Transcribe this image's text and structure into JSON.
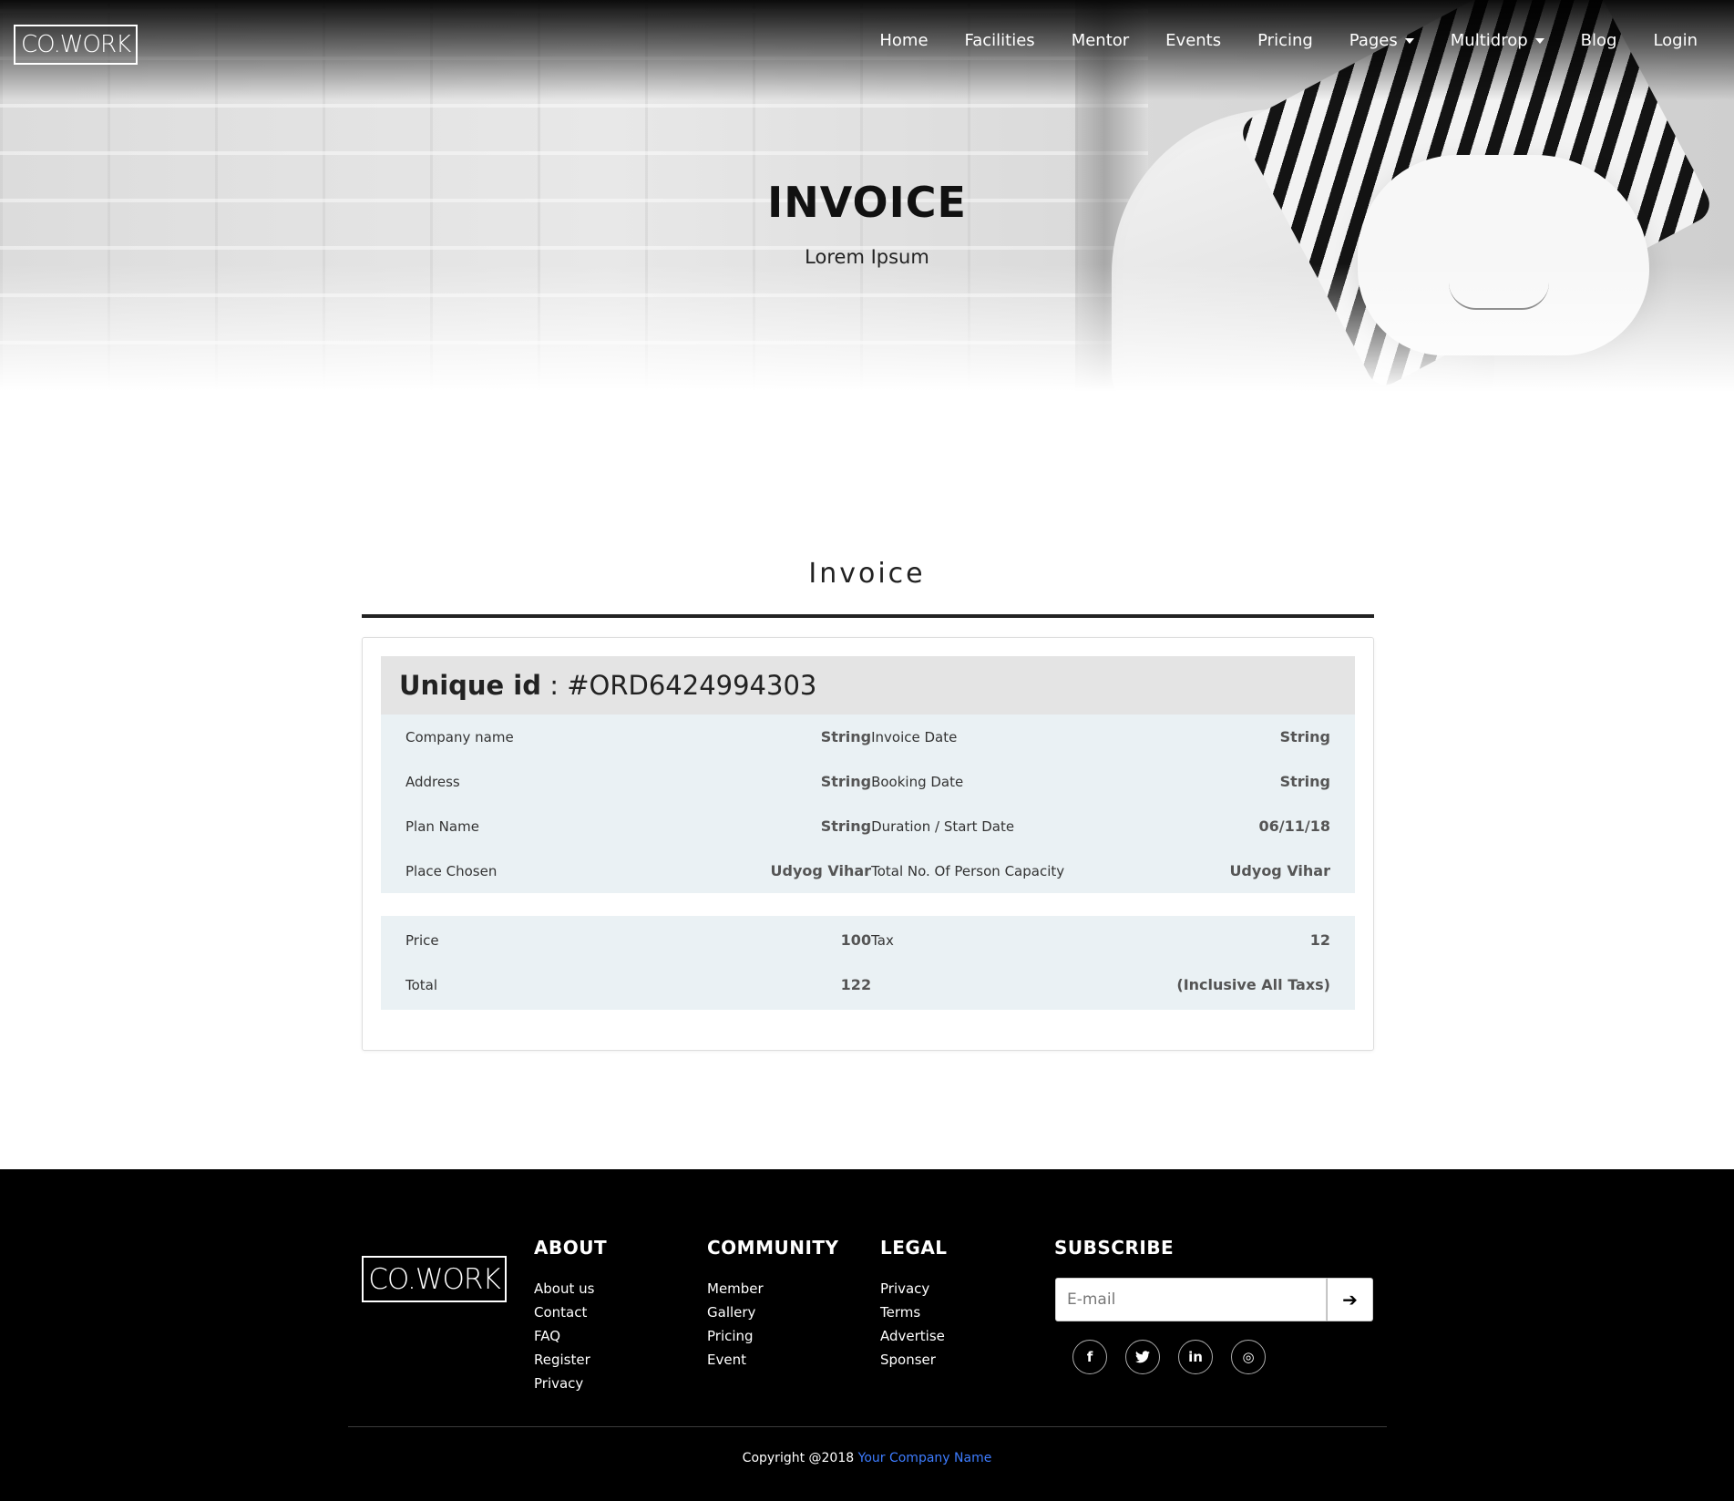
{
  "brand": {
    "logo_text": "CO.WORK"
  },
  "nav": {
    "items": [
      {
        "label": "Home",
        "dropdown": false
      },
      {
        "label": "Facilities",
        "dropdown": false
      },
      {
        "label": "Mentor",
        "dropdown": false
      },
      {
        "label": "Events",
        "dropdown": false
      },
      {
        "label": "Pricing",
        "dropdown": false
      },
      {
        "label": "Pages",
        "dropdown": true
      },
      {
        "label": "Multidrop",
        "dropdown": true
      },
      {
        "label": "Blog",
        "dropdown": false
      },
      {
        "label": "Login",
        "dropdown": false
      }
    ]
  },
  "hero": {
    "title": "INVOICE",
    "subtitle": "Lorem Ipsum"
  },
  "invoice": {
    "section_title": "Invoice",
    "unique_id_label": "Unique id",
    "unique_id_sep": " : ",
    "unique_id_value": "#ORD6424994303",
    "details": [
      {
        "left_label": "Company name",
        "left_value": "String",
        "right_label": "Invoice Date",
        "right_value": "String"
      },
      {
        "left_label": "Address",
        "left_value": "String",
        "right_label": "Booking Date",
        "right_value": "String"
      },
      {
        "left_label": "Plan Name",
        "left_value": "String",
        "right_label": "Duration / Start Date",
        "right_value": "06/11/18"
      },
      {
        "left_label": "Place Chosen",
        "left_value": "Udyog Vihar",
        "right_label": "Total No. Of Person Capacity",
        "right_value": "Udyog Vihar"
      }
    ],
    "totals": [
      {
        "left_label": "Price",
        "left_value": "100",
        "right_label": "Tax",
        "right_value": "12"
      },
      {
        "left_label": "Total",
        "left_value": "122",
        "right_label": "",
        "right_value": "(Inclusive All Taxs)"
      }
    ]
  },
  "footer": {
    "logo_text": "CO.WORK",
    "about": {
      "heading": "ABOUT",
      "links": [
        "About us",
        "Contact",
        "FAQ",
        "Register",
        "Privacy"
      ]
    },
    "community": {
      "heading": "COMMUNITY",
      "links": [
        "Member",
        "Gallery",
        "Pricing",
        "Event"
      ]
    },
    "legal": {
      "heading": "LEGAL",
      "links": [
        "Privacy",
        "Terms",
        "Advertise",
        "Sponser"
      ]
    },
    "subscribe": {
      "heading": "SUBSCRIBE",
      "placeholder": "E-mail",
      "button_icon": "arrow-right-icon"
    },
    "socials": [
      {
        "icon": "facebook-icon",
        "glyph": "f"
      },
      {
        "icon": "twitter-icon",
        "glyph": "t"
      },
      {
        "icon": "linkedin-icon",
        "glyph": "in"
      },
      {
        "icon": "instagram-icon",
        "glyph": "◎"
      }
    ],
    "copyright_prefix": "Copyright @2018",
    "copyright_company": "Your Company Name",
    "link_color": "#3d7cff"
  }
}
